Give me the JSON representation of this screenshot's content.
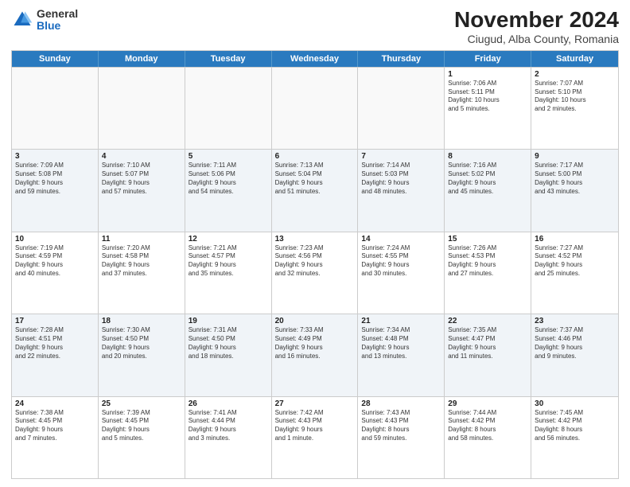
{
  "logo": {
    "general": "General",
    "blue": "Blue"
  },
  "title": "November 2024",
  "subtitle": "Ciugud, Alba County, Romania",
  "header": {
    "days": [
      "Sunday",
      "Monday",
      "Tuesday",
      "Wednesday",
      "Thursday",
      "Friday",
      "Saturday"
    ]
  },
  "rows": [
    [
      {
        "day": "",
        "text": ""
      },
      {
        "day": "",
        "text": ""
      },
      {
        "day": "",
        "text": ""
      },
      {
        "day": "",
        "text": ""
      },
      {
        "day": "",
        "text": ""
      },
      {
        "day": "1",
        "text": "Sunrise: 7:06 AM\nSunset: 5:11 PM\nDaylight: 10 hours\nand 5 minutes."
      },
      {
        "day": "2",
        "text": "Sunrise: 7:07 AM\nSunset: 5:10 PM\nDaylight: 10 hours\nand 2 minutes."
      }
    ],
    [
      {
        "day": "3",
        "text": "Sunrise: 7:09 AM\nSunset: 5:08 PM\nDaylight: 9 hours\nand 59 minutes."
      },
      {
        "day": "4",
        "text": "Sunrise: 7:10 AM\nSunset: 5:07 PM\nDaylight: 9 hours\nand 57 minutes."
      },
      {
        "day": "5",
        "text": "Sunrise: 7:11 AM\nSunset: 5:06 PM\nDaylight: 9 hours\nand 54 minutes."
      },
      {
        "day": "6",
        "text": "Sunrise: 7:13 AM\nSunset: 5:04 PM\nDaylight: 9 hours\nand 51 minutes."
      },
      {
        "day": "7",
        "text": "Sunrise: 7:14 AM\nSunset: 5:03 PM\nDaylight: 9 hours\nand 48 minutes."
      },
      {
        "day": "8",
        "text": "Sunrise: 7:16 AM\nSunset: 5:02 PM\nDaylight: 9 hours\nand 45 minutes."
      },
      {
        "day": "9",
        "text": "Sunrise: 7:17 AM\nSunset: 5:00 PM\nDaylight: 9 hours\nand 43 minutes."
      }
    ],
    [
      {
        "day": "10",
        "text": "Sunrise: 7:19 AM\nSunset: 4:59 PM\nDaylight: 9 hours\nand 40 minutes."
      },
      {
        "day": "11",
        "text": "Sunrise: 7:20 AM\nSunset: 4:58 PM\nDaylight: 9 hours\nand 37 minutes."
      },
      {
        "day": "12",
        "text": "Sunrise: 7:21 AM\nSunset: 4:57 PM\nDaylight: 9 hours\nand 35 minutes."
      },
      {
        "day": "13",
        "text": "Sunrise: 7:23 AM\nSunset: 4:56 PM\nDaylight: 9 hours\nand 32 minutes."
      },
      {
        "day": "14",
        "text": "Sunrise: 7:24 AM\nSunset: 4:55 PM\nDaylight: 9 hours\nand 30 minutes."
      },
      {
        "day": "15",
        "text": "Sunrise: 7:26 AM\nSunset: 4:53 PM\nDaylight: 9 hours\nand 27 minutes."
      },
      {
        "day": "16",
        "text": "Sunrise: 7:27 AM\nSunset: 4:52 PM\nDaylight: 9 hours\nand 25 minutes."
      }
    ],
    [
      {
        "day": "17",
        "text": "Sunrise: 7:28 AM\nSunset: 4:51 PM\nDaylight: 9 hours\nand 22 minutes."
      },
      {
        "day": "18",
        "text": "Sunrise: 7:30 AM\nSunset: 4:50 PM\nDaylight: 9 hours\nand 20 minutes."
      },
      {
        "day": "19",
        "text": "Sunrise: 7:31 AM\nSunset: 4:50 PM\nDaylight: 9 hours\nand 18 minutes."
      },
      {
        "day": "20",
        "text": "Sunrise: 7:33 AM\nSunset: 4:49 PM\nDaylight: 9 hours\nand 16 minutes."
      },
      {
        "day": "21",
        "text": "Sunrise: 7:34 AM\nSunset: 4:48 PM\nDaylight: 9 hours\nand 13 minutes."
      },
      {
        "day": "22",
        "text": "Sunrise: 7:35 AM\nSunset: 4:47 PM\nDaylight: 9 hours\nand 11 minutes."
      },
      {
        "day": "23",
        "text": "Sunrise: 7:37 AM\nSunset: 4:46 PM\nDaylight: 9 hours\nand 9 minutes."
      }
    ],
    [
      {
        "day": "24",
        "text": "Sunrise: 7:38 AM\nSunset: 4:45 PM\nDaylight: 9 hours\nand 7 minutes."
      },
      {
        "day": "25",
        "text": "Sunrise: 7:39 AM\nSunset: 4:45 PM\nDaylight: 9 hours\nand 5 minutes."
      },
      {
        "day": "26",
        "text": "Sunrise: 7:41 AM\nSunset: 4:44 PM\nDaylight: 9 hours\nand 3 minutes."
      },
      {
        "day": "27",
        "text": "Sunrise: 7:42 AM\nSunset: 4:43 PM\nDaylight: 9 hours\nand 1 minute."
      },
      {
        "day": "28",
        "text": "Sunrise: 7:43 AM\nSunset: 4:43 PM\nDaylight: 8 hours\nand 59 minutes."
      },
      {
        "day": "29",
        "text": "Sunrise: 7:44 AM\nSunset: 4:42 PM\nDaylight: 8 hours\nand 58 minutes."
      },
      {
        "day": "30",
        "text": "Sunrise: 7:45 AM\nSunset: 4:42 PM\nDaylight: 8 hours\nand 56 minutes."
      }
    ]
  ]
}
